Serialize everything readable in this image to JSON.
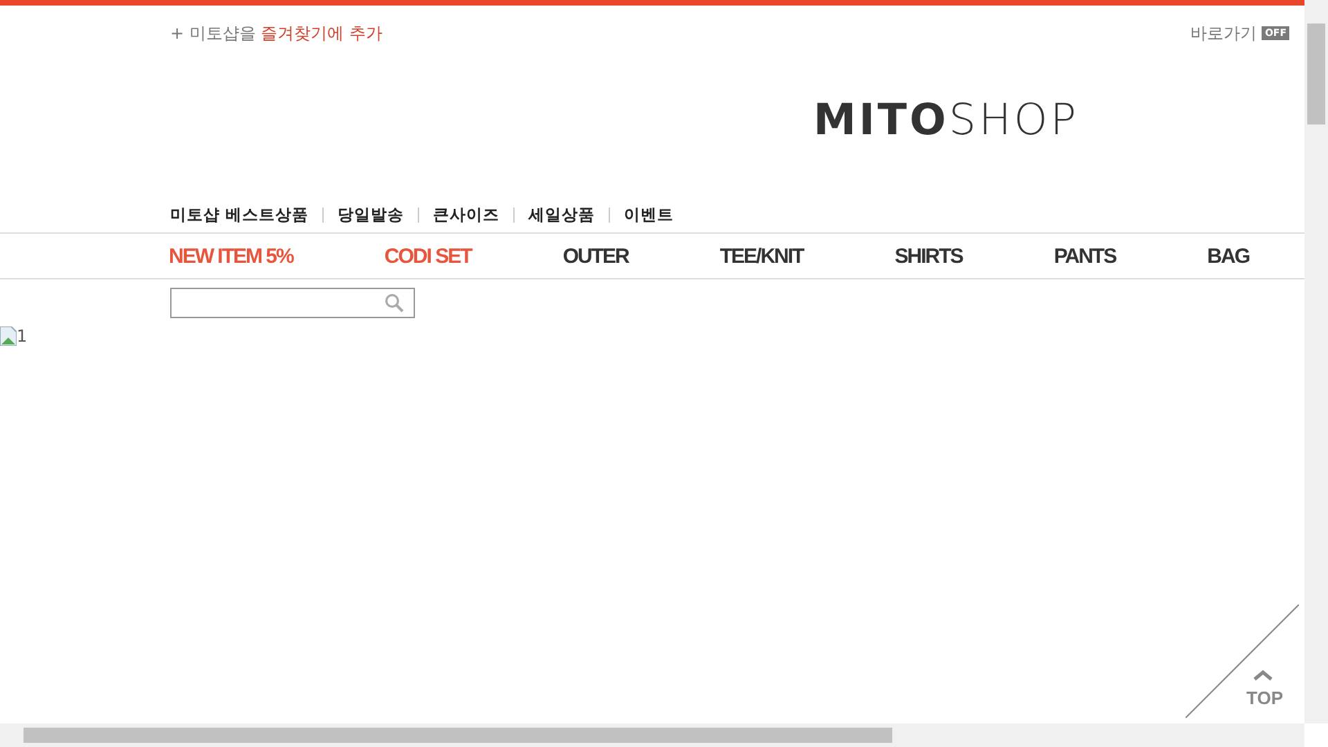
{
  "top_bar": {
    "favorite_prefix": "+ 미토샵을 ",
    "favorite_link": "즐겨찾기에 추가",
    "shortcut_label": "바로가기",
    "shortcut_toggle": "OFF"
  },
  "logo": "**MITO**SHOP",
  "quick_links": [
    "미토샵 베스트상품",
    "당일발송",
    "큰사이즈",
    "세일상품",
    "이벤트"
  ],
  "categories": [
    {
      "label": "NEW ITEM 5%",
      "highlight": true
    },
    {
      "label": "CODI SET",
      "highlight": true
    },
    {
      "label": "OUTER",
      "highlight": false
    },
    {
      "label": "TEE/KNIT",
      "highlight": false
    },
    {
      "label": "SHIRTS",
      "highlight": false
    },
    {
      "label": "PANTS",
      "highlight": false
    },
    {
      "label": "BAG",
      "highlight": false
    }
  ],
  "broken_image_alt": "1",
  "top_button": "TOP"
}
